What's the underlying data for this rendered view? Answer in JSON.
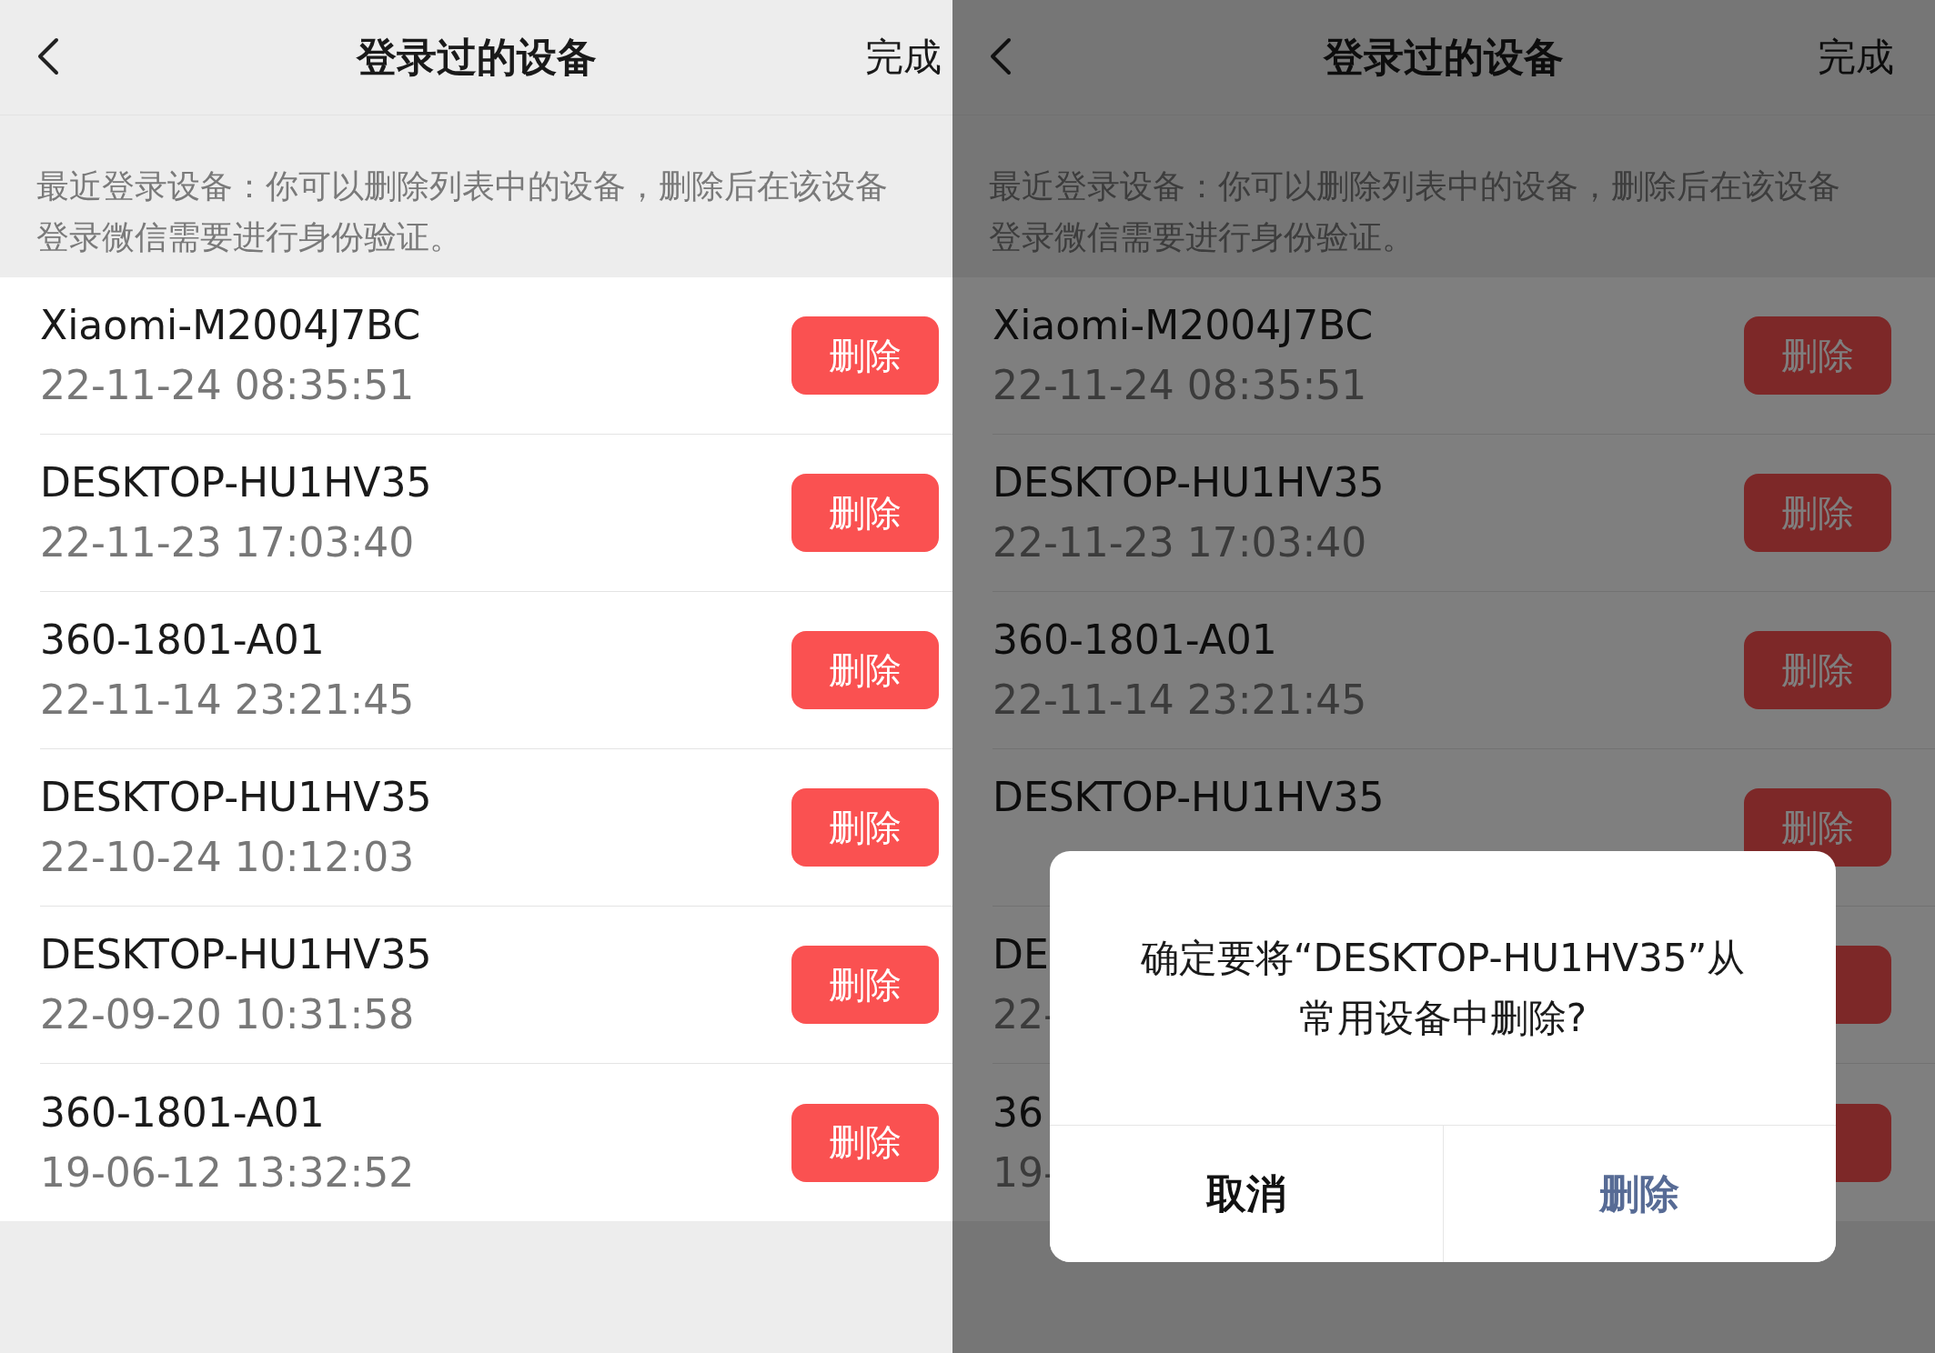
{
  "screens": [
    {
      "dimmed": false,
      "header": {
        "title": "登录过的设备",
        "action": "完成"
      },
      "note": "最近登录设备：你可以删除列表中的设备，删除后在该设备登录微信需要进行身份验证。",
      "devices": [
        {
          "name": "Xiaomi-M2004J7BC",
          "time": "22-11-24 08:35:51",
          "button": "删除"
        },
        {
          "name": "DESKTOP-HU1HV35",
          "time": "22-11-23 17:03:40",
          "button": "删除"
        },
        {
          "name": "360-1801-A01",
          "time": "22-11-14 23:21:45",
          "button": "删除"
        },
        {
          "name": "DESKTOP-HU1HV35",
          "time": "22-10-24 10:12:03",
          "button": "删除"
        },
        {
          "name": "DESKTOP-HU1HV35",
          "time": "22-09-20 10:31:58",
          "button": "删除"
        },
        {
          "name": "360-1801-A01",
          "time": "19-06-12 13:32:52",
          "button": "删除"
        }
      ]
    },
    {
      "dimmed": true,
      "header": {
        "title": "登录过的设备",
        "action": "完成"
      },
      "note": "最近登录设备：你可以删除列表中的设备，删除后在该设备登录微信需要进行身份验证。",
      "devices": [
        {
          "name": "Xiaomi-M2004J7BC",
          "time": "22-11-24 08:35:51",
          "button": "删除"
        },
        {
          "name": "DESKTOP-HU1HV35",
          "time": "22-11-23 17:03:40",
          "button": "删除"
        },
        {
          "name": "360-1801-A01",
          "time": "22-11-14 23:21:45",
          "button": "删除"
        },
        {
          "name": "DESKTOP-HU1HV35",
          "button": "删除"
        },
        {
          "name": "DE",
          "time": "22-"
        },
        {
          "name": "36",
          "time": "19-"
        }
      ],
      "dialog": {
        "message": [
          "确定要将“DESKTOP-HU1HV35”从",
          "常用设备中删除?"
        ],
        "buttons": [
          {
            "label": "取消",
            "kind": "cancel"
          },
          {
            "label": "删除",
            "kind": "confirm"
          }
        ]
      }
    }
  ]
}
